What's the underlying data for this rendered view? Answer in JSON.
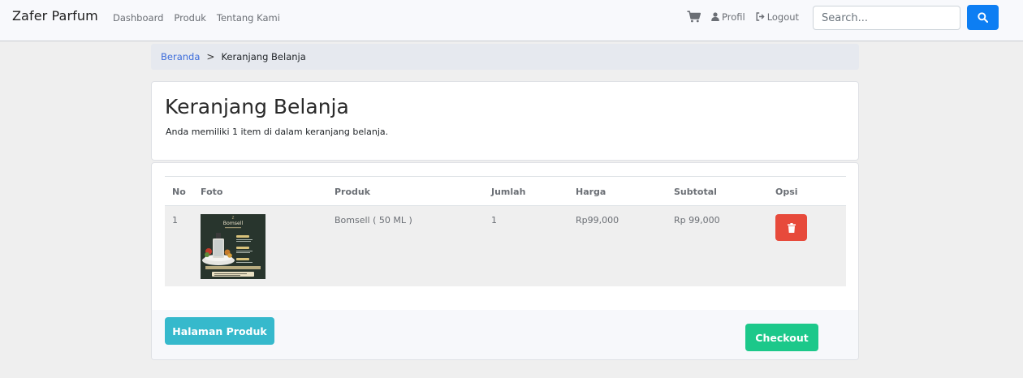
{
  "navbar": {
    "brand": "Zafer Parfum",
    "links": [
      "Dashboard",
      "Produk",
      "Tentang Kami"
    ],
    "profile_label": "Profil",
    "logout_label": "Logout",
    "search_placeholder": "Search..."
  },
  "breadcrumb": {
    "home": "Beranda",
    "separator": ">",
    "current": "Keranjang Belanja"
  },
  "header": {
    "title": "Keranjang Belanja",
    "subtitle": "Anda memiliki 1 item di dalam keranjang belanja."
  },
  "table": {
    "columns": [
      "No",
      "Foto",
      "Produk",
      "Jumlah",
      "Harga",
      "Subtotal",
      "Opsi"
    ],
    "rows": [
      {
        "no": "1",
        "produk": "Bomsell ( 50 ML )",
        "jumlah": "1",
        "harga": "Rp99,000",
        "subtotal": "Rp 99,000",
        "photo_label": "Bomsell"
      }
    ]
  },
  "footer": {
    "halaman_produk_label": "Halaman Produk",
    "checkout_label": "Checkout"
  },
  "colors": {
    "primary": "#0d7ef3",
    "danger": "#e74a3b",
    "info": "#36b9cc",
    "success": "#1cc88a"
  }
}
